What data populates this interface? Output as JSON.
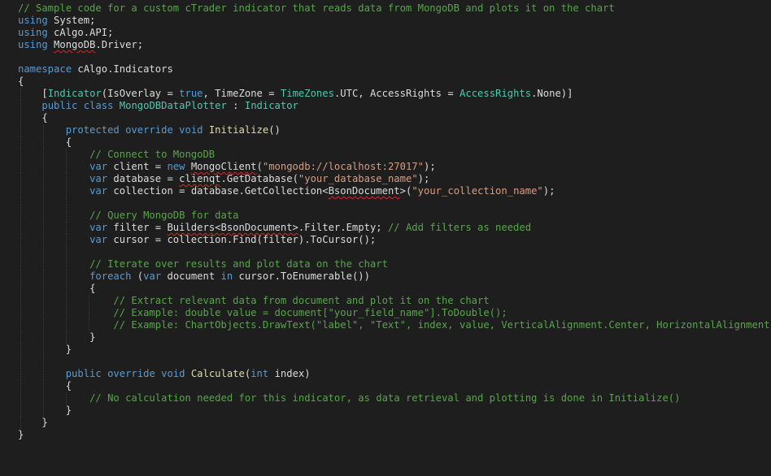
{
  "colors": {
    "background": "#1e1e1e",
    "default": "#dcdcdc",
    "keyword": "#569cd6",
    "comment": "#57a64a",
    "string": "#d69d85",
    "type": "#4ec9b0",
    "method": "#dcdcaa",
    "member": "#bdbdbd",
    "squiggle": "#d22a2a"
  },
  "editor": {
    "language": "C#",
    "lines": [
      {
        "indent": 0,
        "tokens": [
          {
            "t": "// Sample code for a custom cTrader indicator that reads data from MongoDB and plots it on the chart",
            "c": "comment"
          }
        ]
      },
      {
        "indent": 0,
        "tokens": [
          {
            "t": "using",
            "c": "keyword"
          },
          {
            "t": " System;",
            "c": "default"
          }
        ]
      },
      {
        "indent": 0,
        "tokens": [
          {
            "t": "using",
            "c": "keyword"
          },
          {
            "t": " cAlgo.API;",
            "c": "default"
          }
        ]
      },
      {
        "indent": 0,
        "tokens": [
          {
            "t": "using",
            "c": "keyword"
          },
          {
            "t": " ",
            "c": "default"
          },
          {
            "t": "MongoDB",
            "c": "default",
            "sq": true
          },
          {
            "t": ".Driver;",
            "c": "default"
          }
        ]
      },
      {
        "indent": 0,
        "tokens": []
      },
      {
        "indent": 0,
        "tokens": [
          {
            "t": "namespace",
            "c": "keyword"
          },
          {
            "t": " cAlgo.Indicators",
            "c": "default"
          }
        ]
      },
      {
        "indent": 0,
        "tokens": [
          {
            "t": "{",
            "c": "default"
          }
        ]
      },
      {
        "indent": 1,
        "tokens": [
          {
            "t": "[",
            "c": "default"
          },
          {
            "t": "Indicator",
            "c": "type"
          },
          {
            "t": "(IsOverlay = ",
            "c": "default"
          },
          {
            "t": "true",
            "c": "keyword"
          },
          {
            "t": ", TimeZone = ",
            "c": "default"
          },
          {
            "t": "TimeZones",
            "c": "type"
          },
          {
            "t": ".UTC, AccessRights = ",
            "c": "default"
          },
          {
            "t": "AccessRights",
            "c": "type"
          },
          {
            "t": ".None)]",
            "c": "default"
          }
        ]
      },
      {
        "indent": 1,
        "tokens": [
          {
            "t": "public",
            "c": "keyword"
          },
          {
            "t": " ",
            "c": "default"
          },
          {
            "t": "class",
            "c": "keyword"
          },
          {
            "t": " ",
            "c": "default"
          },
          {
            "t": "MongoDBDataPlotter",
            "c": "type"
          },
          {
            "t": " : ",
            "c": "default"
          },
          {
            "t": "Indicator",
            "c": "type"
          }
        ]
      },
      {
        "indent": 1,
        "tokens": [
          {
            "t": "{",
            "c": "default"
          }
        ]
      },
      {
        "indent": 2,
        "tokens": [
          {
            "t": "protected",
            "c": "keyword"
          },
          {
            "t": " ",
            "c": "default"
          },
          {
            "t": "override",
            "c": "keyword"
          },
          {
            "t": " ",
            "c": "default"
          },
          {
            "t": "void",
            "c": "keyword"
          },
          {
            "t": " ",
            "c": "default"
          },
          {
            "t": "Initialize",
            "c": "method"
          },
          {
            "t": "()",
            "c": "default"
          }
        ]
      },
      {
        "indent": 2,
        "tokens": [
          {
            "t": "{",
            "c": "default"
          }
        ]
      },
      {
        "indent": 3,
        "tokens": [
          {
            "t": "// Connect to MongoDB",
            "c": "comment"
          }
        ]
      },
      {
        "indent": 3,
        "tokens": [
          {
            "t": "var",
            "c": "keyword"
          },
          {
            "t": " client = ",
            "c": "default"
          },
          {
            "t": "new",
            "c": "keyword"
          },
          {
            "t": " ",
            "c": "default"
          },
          {
            "t": "MongoClient",
            "c": "default",
            "sq": true
          },
          {
            "t": "(",
            "c": "default"
          },
          {
            "t": "\"mongodb://localhost:27017\"",
            "c": "string"
          },
          {
            "t": ");",
            "c": "default"
          }
        ]
      },
      {
        "indent": 3,
        "tokens": [
          {
            "t": "var",
            "c": "keyword"
          },
          {
            "t": " database = ",
            "c": "default"
          },
          {
            "t": "clienqt",
            "c": "default",
            "sq": true
          },
          {
            "t": ".GetDatabase(",
            "c": "default"
          },
          {
            "t": "\"your_database_name\"",
            "c": "string"
          },
          {
            "t": ");",
            "c": "default"
          }
        ]
      },
      {
        "indent": 3,
        "tokens": [
          {
            "t": "var",
            "c": "keyword"
          },
          {
            "t": " collection = ",
            "c": "default"
          },
          {
            "t": "database",
            "c": "default"
          },
          {
            "t": ".GetCollection<",
            "c": "default"
          },
          {
            "t": "BsonDocument",
            "c": "default",
            "sq": true
          },
          {
            "t": ">(",
            "c": "default"
          },
          {
            "t": "\"your_collection_name\"",
            "c": "string"
          },
          {
            "t": ");",
            "c": "default"
          }
        ]
      },
      {
        "indent": 3,
        "tokens": []
      },
      {
        "indent": 3,
        "tokens": [
          {
            "t": "// Query MongoDB for data",
            "c": "comment"
          }
        ]
      },
      {
        "indent": 3,
        "tokens": [
          {
            "t": "var",
            "c": "keyword"
          },
          {
            "t": " filter = ",
            "c": "default"
          },
          {
            "t": "Builders<BsonDocument>",
            "c": "default",
            "sq": true
          },
          {
            "t": ".Filter.Empty; ",
            "c": "default"
          },
          {
            "t": "// Add filters as needed",
            "c": "comment"
          }
        ]
      },
      {
        "indent": 3,
        "tokens": [
          {
            "t": "var",
            "c": "keyword"
          },
          {
            "t": " cursor = ",
            "c": "default"
          },
          {
            "t": "collection",
            "c": "default"
          },
          {
            "t": ".Find(filter).ToCursor();",
            "c": "default"
          }
        ]
      },
      {
        "indent": 3,
        "tokens": []
      },
      {
        "indent": 3,
        "tokens": [
          {
            "t": "// Iterate over results and plot data on the chart",
            "c": "comment"
          }
        ]
      },
      {
        "indent": 3,
        "tokens": [
          {
            "t": "foreach",
            "c": "keyword"
          },
          {
            "t": " (",
            "c": "default"
          },
          {
            "t": "var",
            "c": "keyword"
          },
          {
            "t": " document ",
            "c": "default"
          },
          {
            "t": "in",
            "c": "keyword"
          },
          {
            "t": " cursor.ToEnumerable())",
            "c": "default"
          }
        ]
      },
      {
        "indent": 3,
        "tokens": [
          {
            "t": "{",
            "c": "default"
          }
        ]
      },
      {
        "indent": 4,
        "tokens": [
          {
            "t": "// Extract relevant data from document and plot it on the chart",
            "c": "comment"
          }
        ]
      },
      {
        "indent": 4,
        "tokens": [
          {
            "t": "// Example: double value = document[\"your_field_name\"].ToDouble();",
            "c": "comment"
          }
        ]
      },
      {
        "indent": 4,
        "tokens": [
          {
            "t": "// Example: ChartObjects.DrawText(\"label\", \"Text\", index, value, VerticalAlignment.Center, HorizontalAlignment.Center",
            "c": "comment"
          }
        ]
      },
      {
        "indent": 3,
        "tokens": [
          {
            "t": "}",
            "c": "default"
          }
        ]
      },
      {
        "indent": 2,
        "tokens": [
          {
            "t": "}",
            "c": "default"
          }
        ]
      },
      {
        "indent": 2,
        "tokens": []
      },
      {
        "indent": 2,
        "tokens": [
          {
            "t": "public",
            "c": "keyword"
          },
          {
            "t": " ",
            "c": "default"
          },
          {
            "t": "override",
            "c": "keyword"
          },
          {
            "t": " ",
            "c": "default"
          },
          {
            "t": "void",
            "c": "keyword"
          },
          {
            "t": " ",
            "c": "default"
          },
          {
            "t": "Calculate",
            "c": "method"
          },
          {
            "t": "(",
            "c": "default"
          },
          {
            "t": "int",
            "c": "keyword"
          },
          {
            "t": " index)",
            "c": "default"
          }
        ]
      },
      {
        "indent": 2,
        "tokens": [
          {
            "t": "{",
            "c": "default"
          }
        ]
      },
      {
        "indent": 3,
        "tokens": [
          {
            "t": "// No calculation needed for this indicator, as data retrieval and plotting is done in Initialize()",
            "c": "comment"
          }
        ]
      },
      {
        "indent": 2,
        "tokens": [
          {
            "t": "}",
            "c": "default"
          }
        ]
      },
      {
        "indent": 1,
        "tokens": [
          {
            "t": "}",
            "c": "default"
          }
        ]
      },
      {
        "indent": 0,
        "tokens": [
          {
            "t": "}",
            "c": "default"
          }
        ]
      }
    ]
  }
}
